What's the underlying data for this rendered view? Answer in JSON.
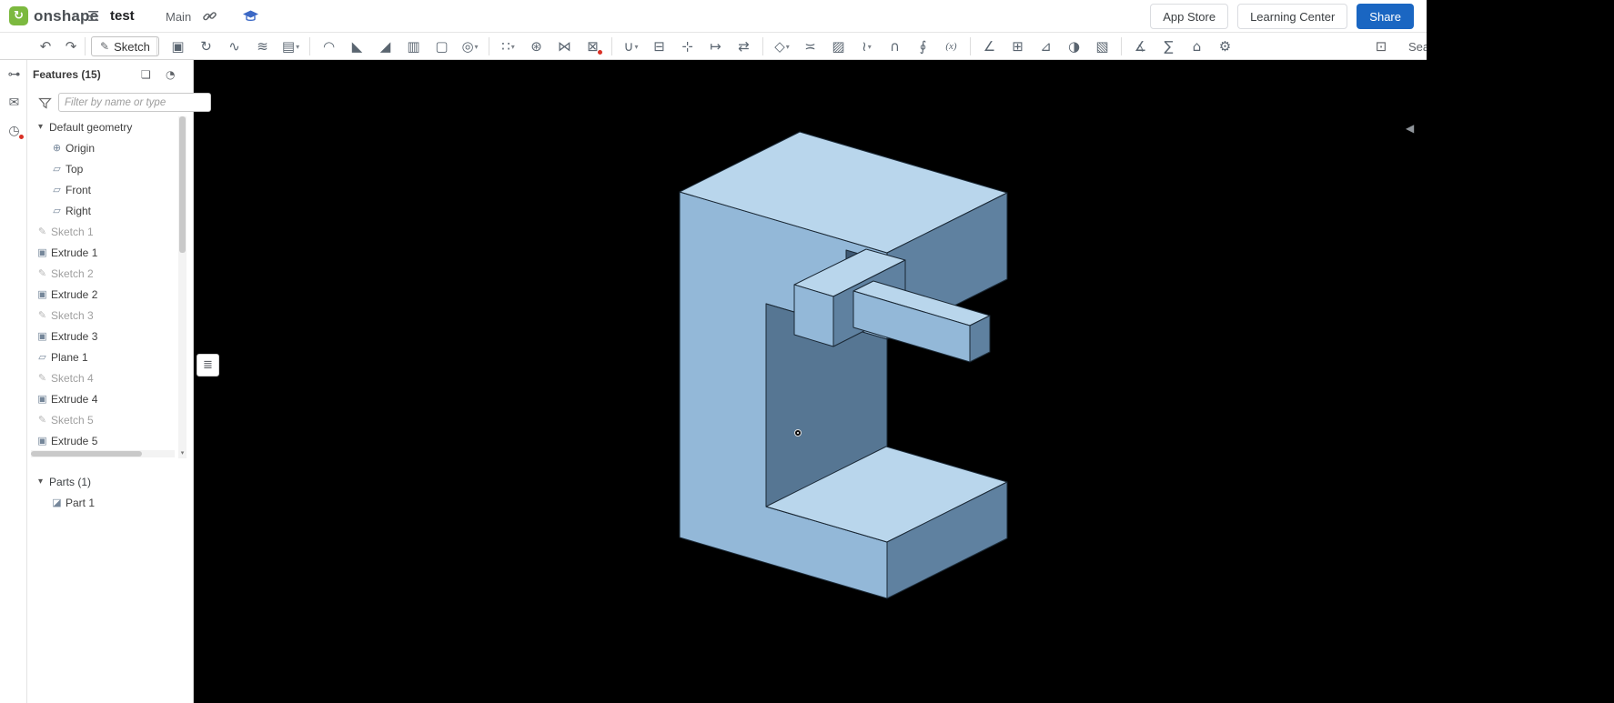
{
  "header": {
    "logo_text": "onshape",
    "logo_mark_glyph": "↻",
    "menu_icon": "☰",
    "document_title": "test",
    "workspace_label": "Main",
    "app_store_label": "App Store",
    "learning_center_label": "Learning Center",
    "share_label": "Share",
    "share_color": "#1a66c2"
  },
  "toolbar": {
    "undo_icon": "↶",
    "redo_icon": "↷",
    "sketch_icon": "✎",
    "sketch_label": "Sketch",
    "fit_icon": "⊡",
    "search_partial_text": "Sea",
    "icons": [
      {
        "name": "extrude-icon",
        "glyph": "▣"
      },
      {
        "name": "revolve-icon",
        "glyph": "↻"
      },
      {
        "name": "sweep-icon",
        "glyph": "∿"
      },
      {
        "name": "loft-icon",
        "glyph": "≋"
      },
      {
        "name": "thicken-icon",
        "glyph": "▤",
        "caret": true
      },
      {
        "name": "separator",
        "sep": true
      },
      {
        "name": "fillet-icon",
        "glyph": "◠"
      },
      {
        "name": "chamfer-icon",
        "glyph": "◣"
      },
      {
        "name": "draft-icon",
        "glyph": "◢"
      },
      {
        "name": "rib-icon",
        "glyph": "▥"
      },
      {
        "name": "shell-icon",
        "glyph": "▢"
      },
      {
        "name": "hole-icon",
        "glyph": "◎",
        "caret": true
      },
      {
        "name": "separator",
        "sep": true
      },
      {
        "name": "linear-pattern-icon",
        "glyph": "∷",
        "caret": true
      },
      {
        "name": "circular-pattern-icon",
        "glyph": "⊛"
      },
      {
        "name": "mirror-icon",
        "glyph": "⋈"
      },
      {
        "name": "delete-part-icon",
        "glyph": "⊠",
        "badge": true
      },
      {
        "name": "separator",
        "sep": true
      },
      {
        "name": "boolean-icon",
        "glyph": "∪",
        "caret": true
      },
      {
        "name": "split-icon",
        "glyph": "⊟"
      },
      {
        "name": "transform-icon",
        "glyph": "⊹"
      },
      {
        "name": "move-face-icon",
        "glyph": "↦"
      },
      {
        "name": "replace-face-icon",
        "glyph": "⇄"
      },
      {
        "name": "separator",
        "sep": true
      },
      {
        "name": "surface-icon",
        "glyph": "◇",
        "caret": true
      },
      {
        "name": "offset-surface-icon",
        "glyph": "≍"
      },
      {
        "name": "fill-surface-icon",
        "glyph": "▨"
      },
      {
        "name": "curve-icon",
        "glyph": "≀",
        "caret": true
      },
      {
        "name": "project-curve-icon",
        "glyph": "∩"
      },
      {
        "name": "helix-icon",
        "glyph": "∮"
      },
      {
        "name": "variable-icon",
        "glyph": "(x)",
        "text": true
      },
      {
        "name": "separator",
        "sep": true
      },
      {
        "name": "sheet-metal-icon",
        "glyph": "∠"
      },
      {
        "name": "frame-icon",
        "glyph": "⊞"
      },
      {
        "name": "weldment-icon",
        "glyph": "⊿"
      },
      {
        "name": "composite-part-icon",
        "glyph": "◑"
      },
      {
        "name": "material-icon",
        "glyph": "▧"
      },
      {
        "name": "separator",
        "sep": true
      },
      {
        "name": "measure-icon",
        "glyph": "∡"
      },
      {
        "name": "mass-properties-icon",
        "glyph": "∑"
      },
      {
        "name": "named-views-icon",
        "glyph": "⌂"
      },
      {
        "name": "settings-icon",
        "glyph": "⚙"
      }
    ]
  },
  "left_rail": {
    "icons": [
      {
        "name": "outline-panel-icon",
        "glyph": "≣"
      },
      {
        "name": "versions-icon",
        "glyph": "⊶"
      },
      {
        "name": "comments-icon",
        "glyph": "✉"
      },
      {
        "name": "history-icon",
        "glyph": "◷",
        "badge": true
      }
    ]
  },
  "features_panel": {
    "title": "Features (15)",
    "float_panel_icon": "❏",
    "rollback_icon": "◔",
    "filter_placeholder": "Filter by name or type",
    "chevron_icon": "▾",
    "scroll_down_icon": "▾",
    "icon_glyphs": {
      "group": "▾",
      "origin": "⊕",
      "plane": "▱",
      "sketch": "✎",
      "extrude": "▣",
      "part": "◪"
    },
    "tree": [
      {
        "label": "Default geometry",
        "type": "group"
      },
      {
        "label": "Origin",
        "type": "origin",
        "child": true
      },
      {
        "label": "Top",
        "type": "plane",
        "child": true
      },
      {
        "label": "Front",
        "type": "plane",
        "child": true
      },
      {
        "label": "Right",
        "type": "plane",
        "child": true
      },
      {
        "label": "Sketch 1",
        "type": "sketch",
        "muted": true
      },
      {
        "label": "Extrude 1",
        "type": "extrude"
      },
      {
        "label": "Sketch 2",
        "type": "sketch",
        "muted": true
      },
      {
        "label": "Extrude 2",
        "type": "extrude"
      },
      {
        "label": "Sketch 3",
        "type": "sketch",
        "muted": true
      },
      {
        "label": "Extrude 3",
        "type": "extrude"
      },
      {
        "label": "Plane 1",
        "type": "plane"
      },
      {
        "label": "Sketch 4",
        "type": "sketch",
        "muted": true
      },
      {
        "label": "Extrude 4",
        "type": "extrude"
      },
      {
        "label": "Sketch 5",
        "type": "sketch",
        "muted": true
      },
      {
        "label": "Extrude 5",
        "type": "extrude"
      }
    ],
    "parts_title": "Parts (1)",
    "parts": [
      {
        "label": "Part 1",
        "type": "part"
      }
    ]
  },
  "canvas": {
    "background": "#000000",
    "feature_toggle_icon": "≣",
    "collapse_icon": "◀",
    "part_colors": {
      "top": "#b9d6ec",
      "left": "#93b8d8",
      "dark": "#5f81a0",
      "interior": "#567693",
      "slot": "#3f5974",
      "edge": "#1a2835"
    }
  }
}
